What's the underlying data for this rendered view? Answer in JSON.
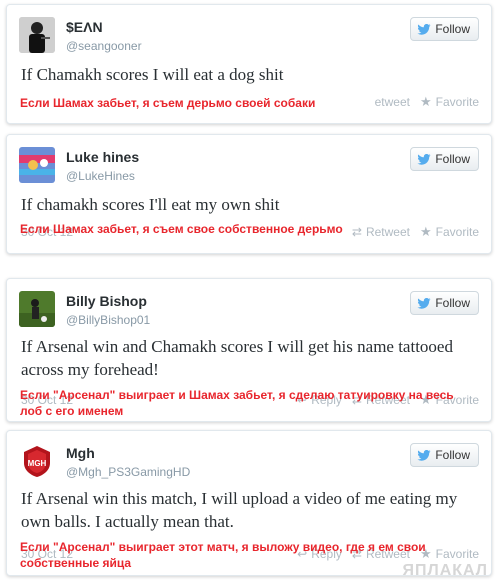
{
  "tweets": [
    {
      "name": "$EΛN",
      "handle": "@seangooner",
      "follow_label": "Follow",
      "text": "If Chamakh scores I will eat a dog shit",
      "translation": "Если Шамах забьет, я съем дерьмо своей собаки",
      "date": "",
      "reply_label": "",
      "retweet_label": "etweet",
      "favorite_label": "Favorite"
    },
    {
      "name": "Luke hines",
      "handle": "@LukeHines",
      "follow_label": "Follow",
      "text": "If chamakh scores I'll eat my own shit",
      "translation": "Если Шамах забьет, я съем свое собственное дерьмо",
      "date": "30 Oct 12",
      "reply_label": "",
      "retweet_label": "Retweet",
      "favorite_label": "Favorite"
    },
    {
      "name": "Billy Bishop",
      "handle": "@BillyBishop01",
      "follow_label": "Follow",
      "text": "If Arsenal win and Chamakh scores I will get his name tattooed across my forehead!",
      "translation": "Если \"Арсенал\" выиграет и Шамах забьет, я сделаю татуировку на весь лоб с его именем",
      "date": "30 Oct 12",
      "reply_label": "Reply",
      "retweet_label": "Retweet",
      "favorite_label": "Favorite"
    },
    {
      "name": "Mgh",
      "handle": "@Mgh_PS3GamingHD",
      "follow_label": "Follow",
      "text": "If Arsenal win this match, I will upload a video of me eating my own balls. I actually mean that.",
      "translation": "Если \"Арсенал\" выиграет этот матч, я выложу видео, где я ем свои собственные яйца",
      "date": "30 Oct 12",
      "reply_label": "Reply",
      "retweet_label": "Retweet",
      "favorite_label": "Favorite"
    }
  ],
  "watermark": "ЯПЛАКАЛ",
  "colors": {
    "translation_red": "#e8262d",
    "follow_bird_blue": "#55acee",
    "action_gray": "#b0bac2"
  },
  "icons": [
    "twitter-bird-icon",
    "reply-icon",
    "retweet-icon",
    "star-icon"
  ]
}
